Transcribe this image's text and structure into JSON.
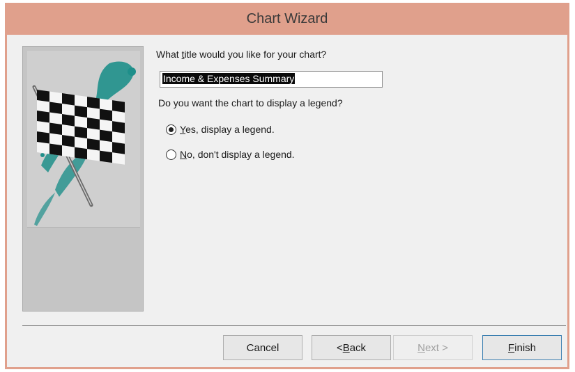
{
  "window": {
    "title": "Chart Wizard"
  },
  "content": {
    "title_prompt": {
      "before": "What ",
      "access_key": "t",
      "after": "itle would you like for your chart?"
    },
    "title_value": "Income & Expenses Summary",
    "legend_prompt": "Do you want the chart to display a legend?",
    "legend_options": [
      {
        "access_key": "Y",
        "rest": "es, display a legend.",
        "checked": true
      },
      {
        "access_key": "N",
        "rest": "o, don't display a legend.",
        "checked": false
      }
    ]
  },
  "buttons": {
    "cancel": "Cancel",
    "back": {
      "before": "< ",
      "access_key": "B",
      "after": "ack"
    },
    "next": {
      "access_key": "N",
      "after": "ext >"
    },
    "finish": {
      "access_key": "F",
      "after": "inish"
    }
  },
  "colors": {
    "titlebar": "#e0a08c",
    "flag_splash": "#1e8f8a"
  },
  "icons": {
    "side": "checkered-flag-icon"
  }
}
